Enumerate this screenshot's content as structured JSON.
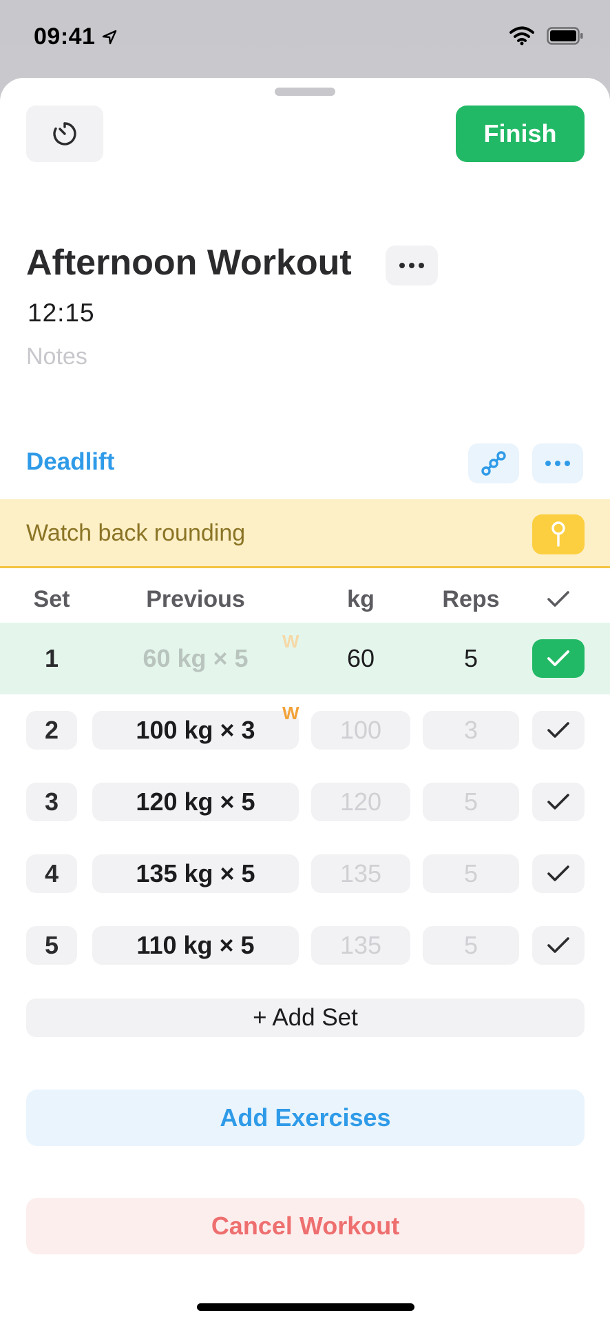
{
  "status_bar": {
    "time": "09:41",
    "icons": [
      "location-arrow-icon",
      "wifi-icon",
      "battery-icon"
    ]
  },
  "header": {
    "timer_icon": "timer-icon",
    "finish_label": "Finish"
  },
  "workout": {
    "title": "Afternoon Workout",
    "more_icon": "ellipsis-icon",
    "elapsed": "12:15",
    "notes_placeholder": "Notes"
  },
  "exercise": {
    "name": "Deadlift",
    "link_icon": "chain-link-icon",
    "more_icon": "ellipsis-icon",
    "note": "Watch back rounding",
    "pin_icon": "pin-icon",
    "columns": {
      "set": "Set",
      "previous": "Previous",
      "kg": "kg",
      "reps": "Reps",
      "check_icon": "checkmark-icon"
    },
    "sets": [
      {
        "set": "1",
        "previous": "60 kg × 5",
        "kg": "60",
        "reps": "5",
        "warmup": "W",
        "done": true
      },
      {
        "set": "2",
        "previous": "100 kg × 3",
        "kg": "100",
        "reps": "3",
        "warmup": "W",
        "done": false
      },
      {
        "set": "3",
        "previous": "120 kg × 5",
        "kg": "120",
        "reps": "5",
        "warmup": "",
        "done": false
      },
      {
        "set": "4",
        "previous": "135 kg × 5",
        "kg": "135",
        "reps": "5",
        "warmup": "",
        "done": false
      },
      {
        "set": "5",
        "previous": "110 kg × 5",
        "kg": "135",
        "reps": "5",
        "warmup": "",
        "done": false
      }
    ],
    "add_set_label": "+ Add Set"
  },
  "actions": {
    "add_exercises_label": "Add Exercises",
    "cancel_workout_label": "Cancel Workout"
  },
  "colors": {
    "accent_green": "#22b966",
    "accent_blue": "#2f9be8",
    "note_yellow": "#fdefc6",
    "cancel_red": "#ee6f6f"
  }
}
